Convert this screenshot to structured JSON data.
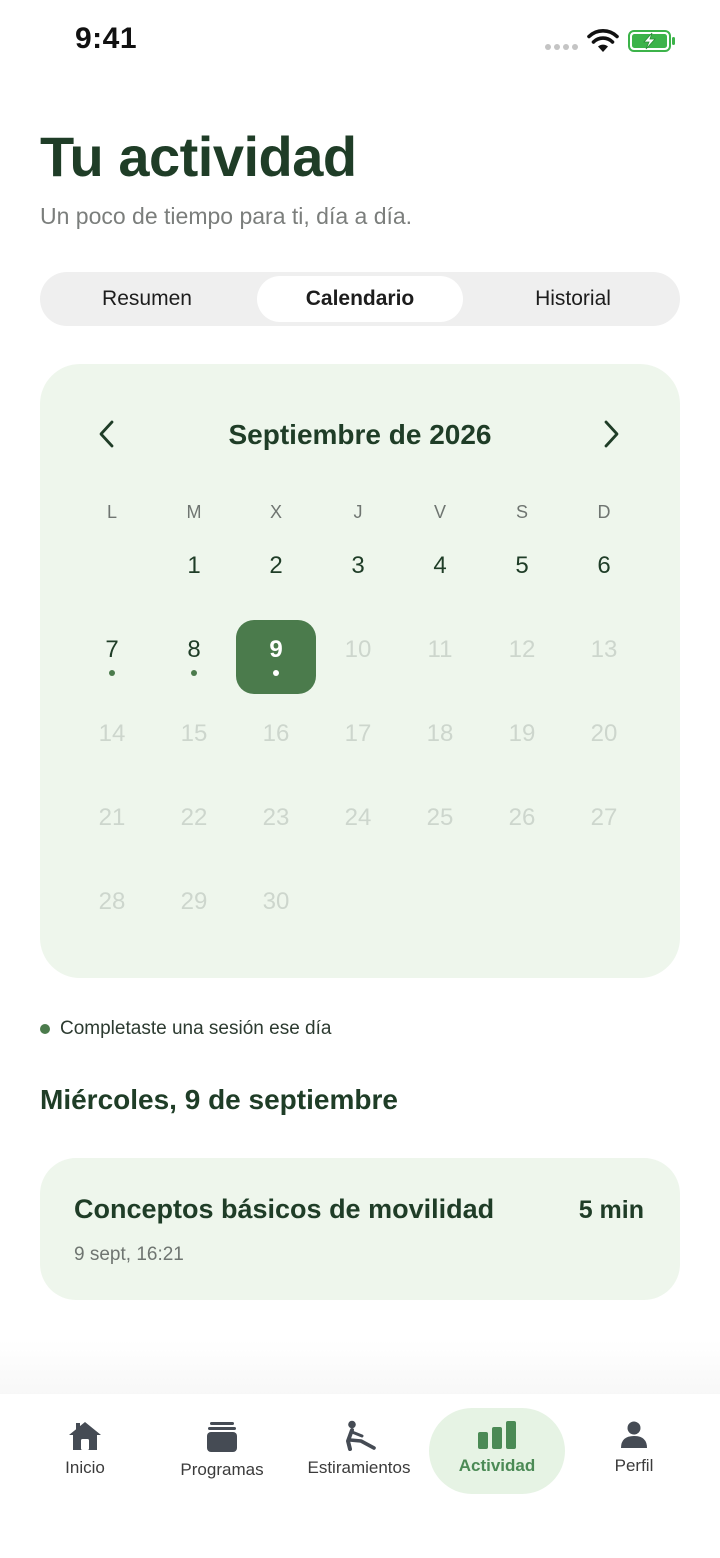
{
  "status_bar": {
    "time": "9:41"
  },
  "header": {
    "title": "Tu actividad",
    "subtitle": "Un poco de tiempo para ti, día a día."
  },
  "segments": {
    "resumen": "Resumen",
    "calendario": "Calendario",
    "historial": "Historial",
    "selected": "Calendario"
  },
  "calendar": {
    "month_label": "Septiembre de 2026",
    "weekdays": [
      "L",
      "M",
      "X",
      "J",
      "V",
      "S",
      "D"
    ],
    "first_weekday_offset": 1,
    "days_in_month": 30,
    "today": 9,
    "selected_day": 9,
    "session_days": [
      7,
      8,
      9
    ]
  },
  "legend": {
    "text": "Completaste una sesión ese día"
  },
  "day_detail": {
    "heading": "Miércoles, 9 de septiembre",
    "session": {
      "title": "Conceptos básicos de movilidad",
      "duration": "5 min",
      "datetime": "9 sept, 16:21"
    }
  },
  "tabbar": {
    "inicio": "Inicio",
    "programas": "Programas",
    "estiramientos": "Estiramientos",
    "actividad": "Actividad",
    "perfil": "Perfil",
    "active": "Actividad"
  },
  "colors": {
    "primary": "#4b7b4c",
    "title": "#1f3d27",
    "card_bg": "#eef6ec",
    "active_tab_bg": "#e6f3e4"
  }
}
